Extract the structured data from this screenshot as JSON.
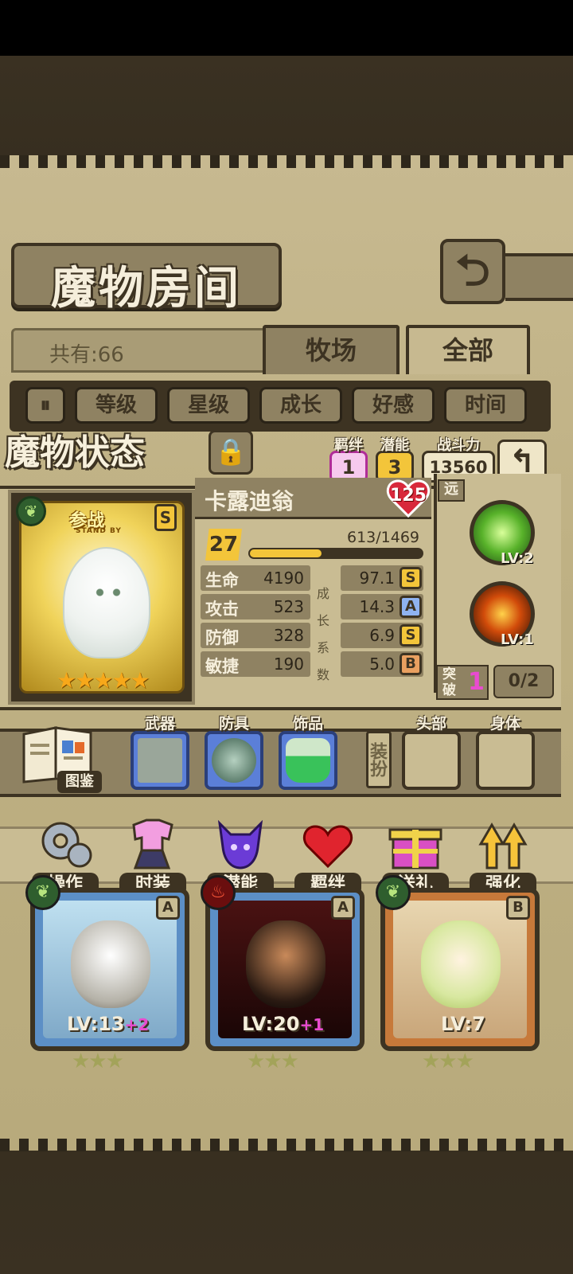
{
  "header": {
    "title": "魔物房间",
    "back_icon": "return-arrow-icon"
  },
  "count_label": "共有:66",
  "tabs": [
    {
      "label": "牧场"
    },
    {
      "label": "全部"
    }
  ],
  "filters": {
    "sort_icon": "sort-toggle-icon",
    "items": [
      "等级",
      "星级",
      "成长",
      "好感",
      "时间"
    ]
  },
  "status": {
    "title": "魔物状态",
    "bond_label": "羁绊",
    "bond_value": "1",
    "potential_label": "潜能",
    "potential_value": "3",
    "power_label": "战斗力",
    "power_value": "13560"
  },
  "monster": {
    "name": "卡露迪翁",
    "affection": "125",
    "level": "27",
    "exp_text": "613/1469",
    "exp_fraction": 0.417,
    "standby_label": "参战",
    "standby_sub": "STAND BY",
    "rank": "S",
    "stars": "★★★★★",
    "growth_label": [
      "成",
      "长",
      "系",
      "数"
    ],
    "stats": [
      {
        "label": "生命",
        "value": "4190",
        "growth": "97.1",
        "grade": "S"
      },
      {
        "label": "攻击",
        "value": "523",
        "growth": "14.3",
        "grade": "A"
      },
      {
        "label": "防御",
        "value": "328",
        "growth": "6.9",
        "grade": "S"
      },
      {
        "label": "敏捷",
        "value": "190",
        "growth": "5.0",
        "grade": "B"
      }
    ],
    "range_label": "远",
    "skills": [
      {
        "level": "LV:2"
      },
      {
        "level": "LV:1"
      }
    ],
    "breakthrough_label": "突破",
    "breakthrough_value": "1",
    "breakthrough_progress": "0/2"
  },
  "equipment": {
    "book_label": "图鉴",
    "weapon_label": "武器",
    "armor_label": "防具",
    "accessory_label": "饰品",
    "dress_label": "装扮",
    "head_label": "头部",
    "body_label": "身体"
  },
  "actions": [
    "操作",
    "时装",
    "潜能",
    "羁绊",
    "送礼",
    "强化"
  ],
  "roster": [
    {
      "level": "LV:13",
      "plus": "+2",
      "grade": "A"
    },
    {
      "level": "LV:20",
      "plus": "+1",
      "grade": "A"
    },
    {
      "level": "LV:7",
      "plus": "",
      "grade": "B"
    }
  ],
  "roster_stars": "★★★",
  "colors": {
    "accent_gold": "#f3c53a",
    "frame_dark": "#3d3322",
    "parchment": "#c9bc93",
    "pink": "#e94bd0",
    "blue_slot": "#5b7fd8"
  }
}
